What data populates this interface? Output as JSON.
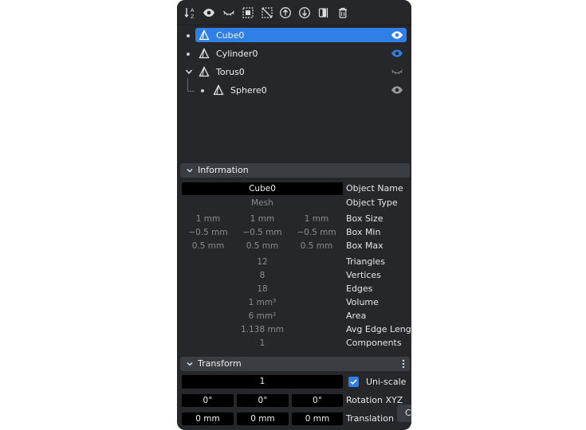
{
  "toolbar": {
    "icons": [
      "sort-alpha-icon",
      "show-all-icon",
      "hide-all-icon",
      "select-all-icon",
      "deselect-icon",
      "move-up-icon",
      "move-down-icon",
      "mirror-icon",
      "delete-icon"
    ]
  },
  "outliner": {
    "items": [
      {
        "label": "Cube0",
        "selected": true,
        "visible": true
      },
      {
        "label": "Cylinder0",
        "selected": false,
        "visible": true
      },
      {
        "label": "Torus0",
        "selected": false,
        "visible": false,
        "expanded": true
      },
      {
        "label": "Sphere0",
        "selected": false,
        "visible": true,
        "child": true
      }
    ]
  },
  "information": {
    "title": "Information",
    "object_name_value": "Cube0",
    "object_name_label": "Object Name",
    "object_type_value": "Mesh",
    "object_type_label": "Object Type",
    "box_size": [
      "1 mm",
      "1 mm",
      "1 mm"
    ],
    "box_size_label": "Box Size",
    "box_min": [
      "−0.5 mm",
      "−0.5 mm",
      "−0.5 mm"
    ],
    "box_min_label": "Box Min",
    "box_max": [
      "0.5 mm",
      "0.5 mm",
      "0.5 mm"
    ],
    "box_max_label": "Box Max",
    "triangles_value": "12",
    "triangles_label": "Triangles",
    "vertices_value": "8",
    "vertices_label": "Vertices",
    "edges_value": "18",
    "edges_label": "Edges",
    "volume_value": "1 mm³",
    "volume_label": "Volume",
    "area_value": "6 mm²",
    "area_label": "Area",
    "avg_edge_value": "1.138 mm",
    "avg_edge_label": "Avg Edge Length",
    "components_value": "1",
    "components_label": "Components"
  },
  "transform": {
    "title": "Transform",
    "scale_value": "1",
    "uni_scale_label": "Uni-scale",
    "uni_scale_checked": true,
    "rotation": [
      "0°",
      "0°",
      "0°"
    ],
    "rotation_label": "Rotation XYZ",
    "translation": [
      "0 mm",
      "0 mm",
      "0 mm"
    ],
    "translation_label": "Translation",
    "clipped_button_label": "C"
  },
  "colors": {
    "panel_bg": "#25272a",
    "accent": "#2f7fe6",
    "field_bg": "#000000",
    "header_bg": "#3a3d41"
  }
}
